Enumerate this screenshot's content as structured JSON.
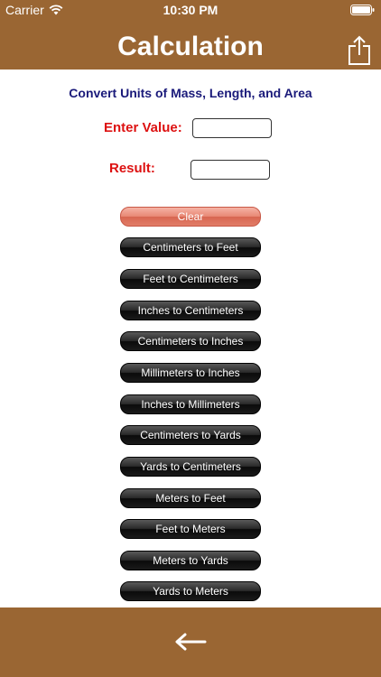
{
  "status_bar": {
    "carrier": "Carrier",
    "time": "10:30 PM"
  },
  "nav": {
    "title": "Calculation",
    "share_icon": "share-icon"
  },
  "form": {
    "subtitle": "Convert Units of Mass, Length, and Area",
    "enter_label": "Enter Value:",
    "enter_value": "",
    "result_label": "Result:",
    "result_value": ""
  },
  "buttons": {
    "clear": "Clear",
    "conversions": [
      "Centimeters to Feet",
      "Feet to Centimeters",
      "Inches to Centimeters",
      "Centimeters to Inches",
      "Millimeters to Inches",
      "Inches to Millimeters",
      "Centimeters to Yards",
      "Yards to Centimeters",
      "Meters to Feet",
      "Feet to Meters",
      "Meters to Yards",
      "Yards to Meters"
    ]
  },
  "footer": {
    "back_icon": "back-arrow-icon"
  },
  "colors": {
    "bar_brown": "#9a6633",
    "subtitle_navy": "#1a1a7a",
    "label_red": "#dd1111",
    "clear_salmon": "#e88774"
  }
}
